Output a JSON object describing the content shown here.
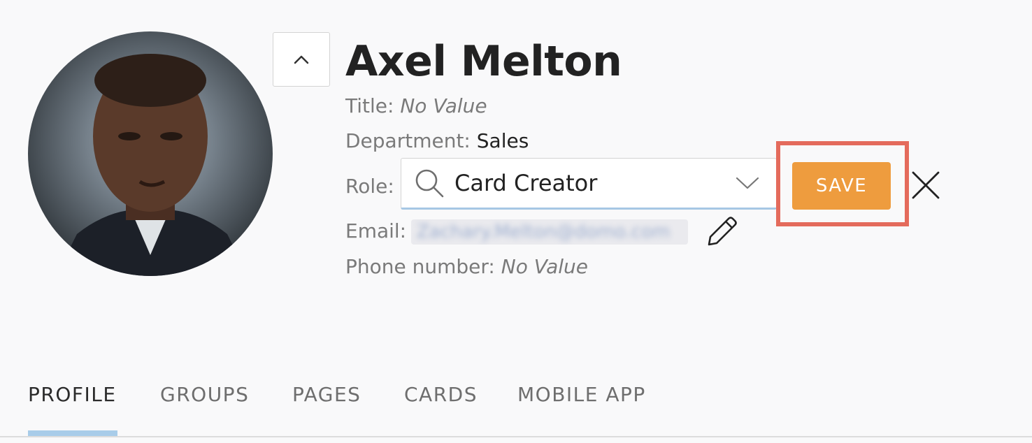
{
  "user": {
    "name": "Axel Melton",
    "avatar_alt": "profile photo"
  },
  "fields": {
    "title_label": "Title:",
    "title_value": "No Value",
    "department_label": "Department:",
    "department_value": "Sales",
    "role_label": "Role:",
    "role_value": "Card Creator",
    "email_label": "Email:",
    "email_value": "Zachary.Melton@domo.com",
    "phone_label": "Phone number:",
    "phone_value": "No Value"
  },
  "actions": {
    "save_label": "SAVE"
  },
  "icons": {
    "collapse": "chevron-up-icon",
    "search": "search-icon",
    "dropdown": "chevron-down-icon",
    "edit": "pencil-icon",
    "close": "close-icon"
  },
  "tabs": [
    {
      "label": "PROFILE",
      "active": true
    },
    {
      "label": "GROUPS",
      "active": false
    },
    {
      "label": "PAGES",
      "active": false
    },
    {
      "label": "CARDS",
      "active": false
    },
    {
      "label": "MOBILE APP",
      "active": false
    }
  ],
  "colors": {
    "save_button": "#ee9c3e",
    "highlight_border": "#e46b5c",
    "active_tab_underline": "#a8cce9"
  }
}
